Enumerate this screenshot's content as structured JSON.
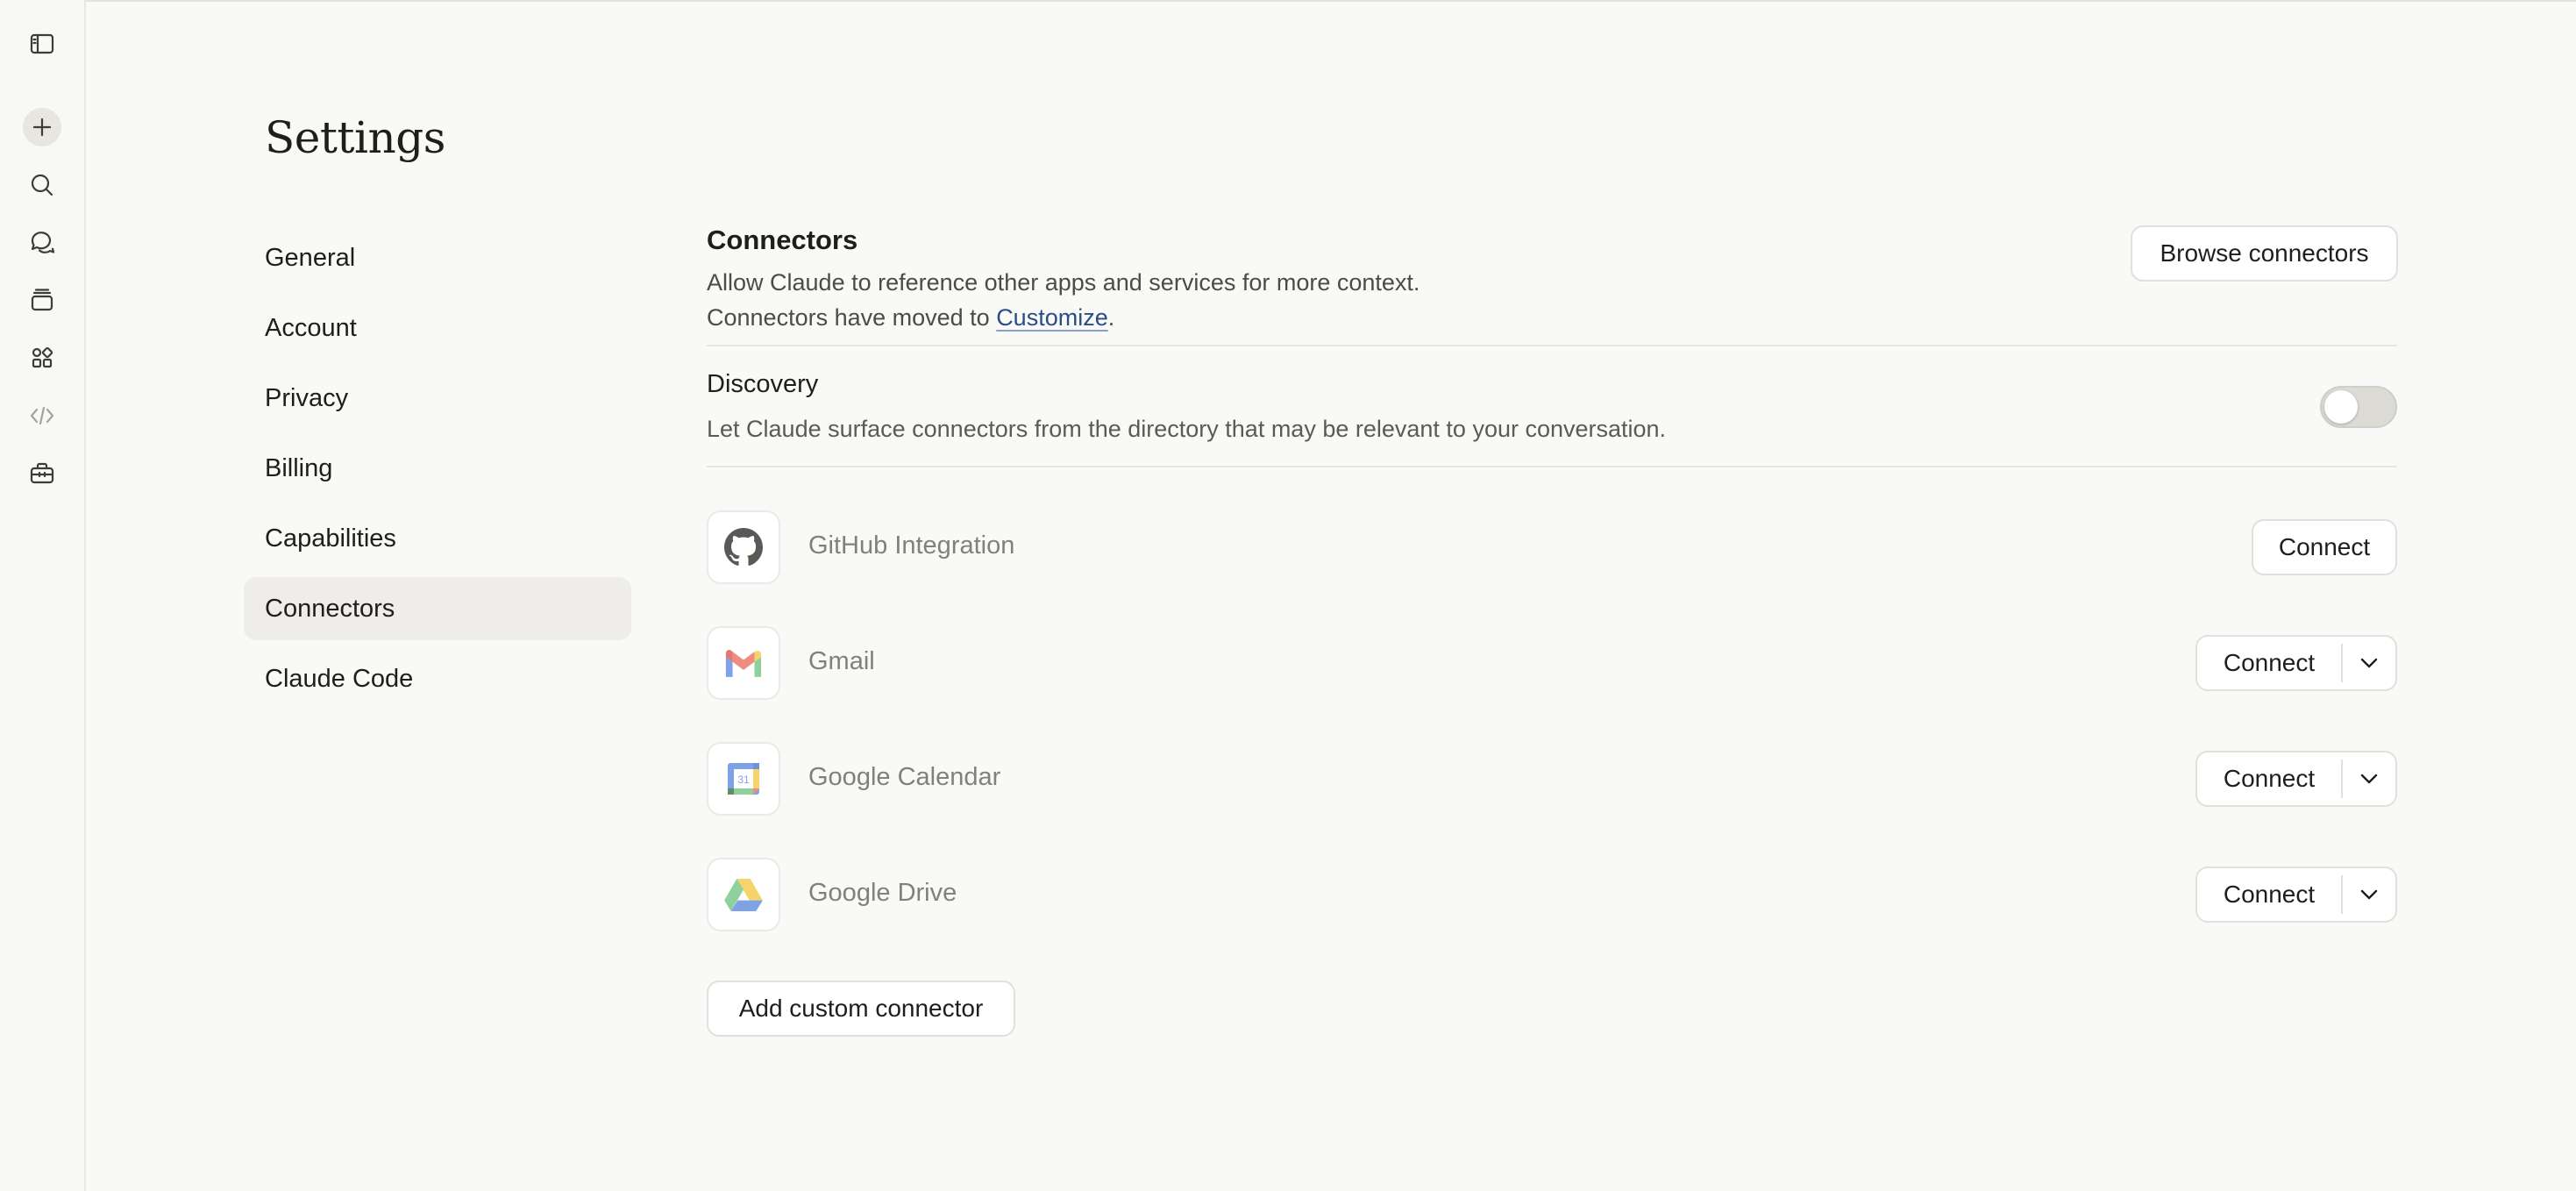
{
  "page": {
    "title": "Settings"
  },
  "rail": {
    "icons": [
      "sidebar-toggle-icon",
      "new-chat-plus-icon",
      "search-icon",
      "chats-icon",
      "projects-icon",
      "artifacts-icon",
      "code-icon",
      "toolbox-icon"
    ]
  },
  "nav": {
    "items": [
      {
        "label": "General"
      },
      {
        "label": "Account"
      },
      {
        "label": "Privacy"
      },
      {
        "label": "Billing"
      },
      {
        "label": "Capabilities"
      },
      {
        "label": "Connectors",
        "active": true
      },
      {
        "label": "Claude Code"
      }
    ]
  },
  "connectors": {
    "title": "Connectors",
    "description_line1": "Allow Claude to reference other apps and services for more context.",
    "description_line2_prefix": "Connectors have moved to ",
    "description_line2_link": "Customize",
    "description_line2_suffix": ".",
    "browse_label": "Browse connectors"
  },
  "discovery": {
    "title": "Discovery",
    "description": "Let Claude surface connectors from the directory that may be relevant to your conversation.",
    "enabled": false
  },
  "items": [
    {
      "name": "GitHub Integration",
      "icon": "github-icon",
      "button": "Connect",
      "has_dropdown": false
    },
    {
      "name": "Gmail",
      "icon": "gmail-icon",
      "button": "Connect",
      "has_dropdown": true
    },
    {
      "name": "Google Calendar",
      "icon": "google-calendar-icon",
      "button": "Connect",
      "has_dropdown": true,
      "icon_text": "31"
    },
    {
      "name": "Google Drive",
      "icon": "google-drive-icon",
      "button": "Connect",
      "has_dropdown": true
    }
  ],
  "add_custom_label": "Add custom connector",
  "colors": {
    "background": "#f9f9f7",
    "link": "#2a4d86",
    "active_nav": "#eeede9"
  }
}
